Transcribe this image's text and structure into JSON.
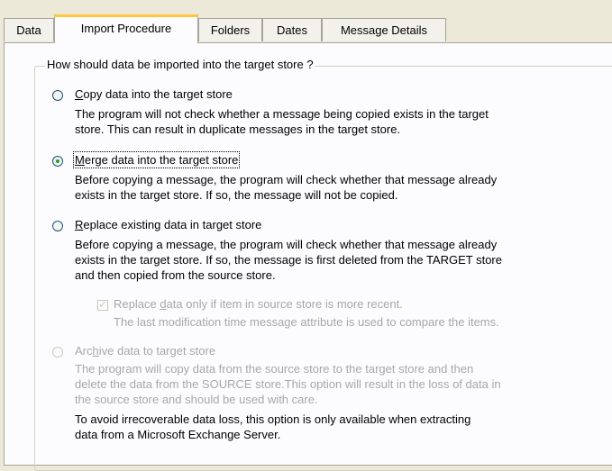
{
  "tabs": [
    {
      "label": "Data"
    },
    {
      "label": "Import Procedure"
    },
    {
      "label": "Folders"
    },
    {
      "label": "Dates"
    },
    {
      "label": "Message Details"
    }
  ],
  "group": {
    "title": "How should data be imported into the target store ?"
  },
  "options": {
    "copy": {
      "mnemonic": "C",
      "label_rest": "opy data into the target store",
      "desc": [
        "The program will not check whether a message being copied exists in the target",
        "store. This can result in duplicate messages in the target store."
      ],
      "checked": false
    },
    "merge": {
      "mnemonic": "M",
      "label_rest": "erge data into the target store",
      "desc": [
        "Before copying a message, the program will check whether that message already",
        "exists in the target store. If so, the message will not be copied."
      ],
      "checked": true
    },
    "replace": {
      "mnemonic": "R",
      "label_rest": "eplace existing data in target store",
      "desc": [
        "Before copying a message, the program will check whether that message already",
        "exists in the target store. If so, the message is first deleted from the TARGET store",
        "and then copied from the source store."
      ],
      "checked": false
    },
    "replace_recent": {
      "label_pre": "Replace ",
      "mnemonic": "d",
      "label_rest": "ata only if item in source store is more recent.",
      "desc": "The last modification time message attribute is used to compare the items.",
      "checked": true,
      "disabled": true
    },
    "archive": {
      "label_pre": "Arc",
      "mnemonic": "h",
      "label_rest": "ive data to target store",
      "desc": [
        "The program will copy data from the source store to the target store and then",
        "delete the data from the SOURCE store.This option will result in the loss of data in",
        "the source store and should be used with care."
      ],
      "note": [
        "To avoid irrecoverable data loss, this option is only available when extracting",
        "data from a Microsoft Exchange Server."
      ],
      "checked": false,
      "disabled": true
    }
  }
}
